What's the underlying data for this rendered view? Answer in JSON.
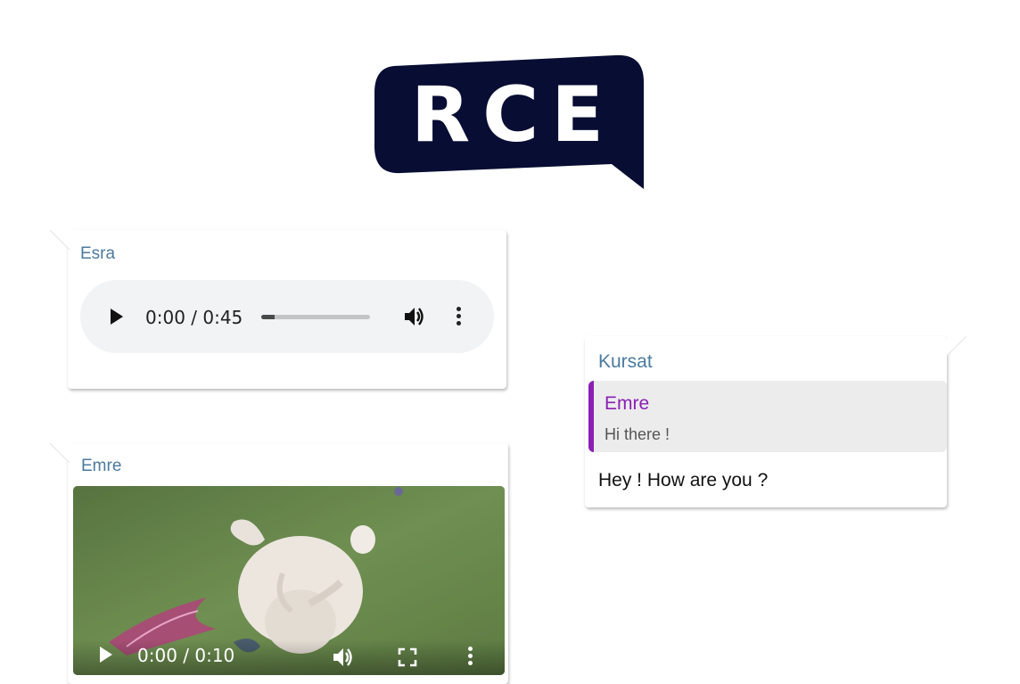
{
  "logo": {
    "text": "RCE",
    "bg_color": "#070d33"
  },
  "messages": [
    {
      "sender": "Esra",
      "type": "audio",
      "audio": {
        "time": "0:00 / 0:45",
        "progress": 0.12
      }
    },
    {
      "sender": "Kursat",
      "type": "reply",
      "reply": {
        "name": "Emre",
        "text": "Hi there !"
      },
      "text": "Hey ! How are you ?"
    },
    {
      "sender": "Emre",
      "type": "video",
      "video": {
        "time": "0:00 / 0:10"
      }
    }
  ],
  "colors": {
    "sender": "#4b7aa0",
    "reply_accent": "#8b1fb5",
    "player_bg": "#f1f3f4"
  },
  "icons": [
    "play-icon",
    "volume-icon",
    "more-vert-icon",
    "fullscreen-icon"
  ]
}
